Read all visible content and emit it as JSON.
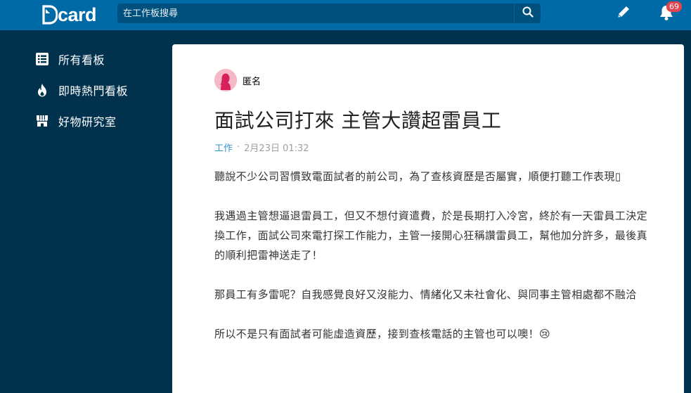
{
  "header": {
    "logo_text": "card",
    "search_placeholder": "在工作板搜尋",
    "notification_count": "69",
    "accent": "#006aa6"
  },
  "sidebar": {
    "items": [
      {
        "label": "所有看板",
        "icon": "list-icon"
      },
      {
        "label": "即時熱門看板",
        "icon": "fire-icon"
      },
      {
        "label": "好物研究室",
        "icon": "store-icon"
      }
    ]
  },
  "post": {
    "author": "匿名",
    "title": "面試公司打來 主管大讚超雷員工",
    "forum": "工作",
    "separator": "·",
    "date": "2月23日 01:32",
    "paragraphs": [
      "聽說不少公司習慣致電面試者的前公司，為了查核資歷是否屬實，順便打聽工作表現▯",
      "我遇過主管想逼退雷員工，但又不想付資遣費，於是長期打入冷宮，終於有一天雷員工決定換工作，面試公司來電打探工作能力，主管一接開心狂稱讚雷員工，幫他加分許多，最後真的順利把雷神送走了！",
      "那員工有多雷呢？自我感覺良好又沒能力、情緒化又未社會化、與同事主管相處都不融洽",
      "所以不是只有面試者可能虛造資歷，接到查核電話的主管也可以噢！😢"
    ]
  }
}
